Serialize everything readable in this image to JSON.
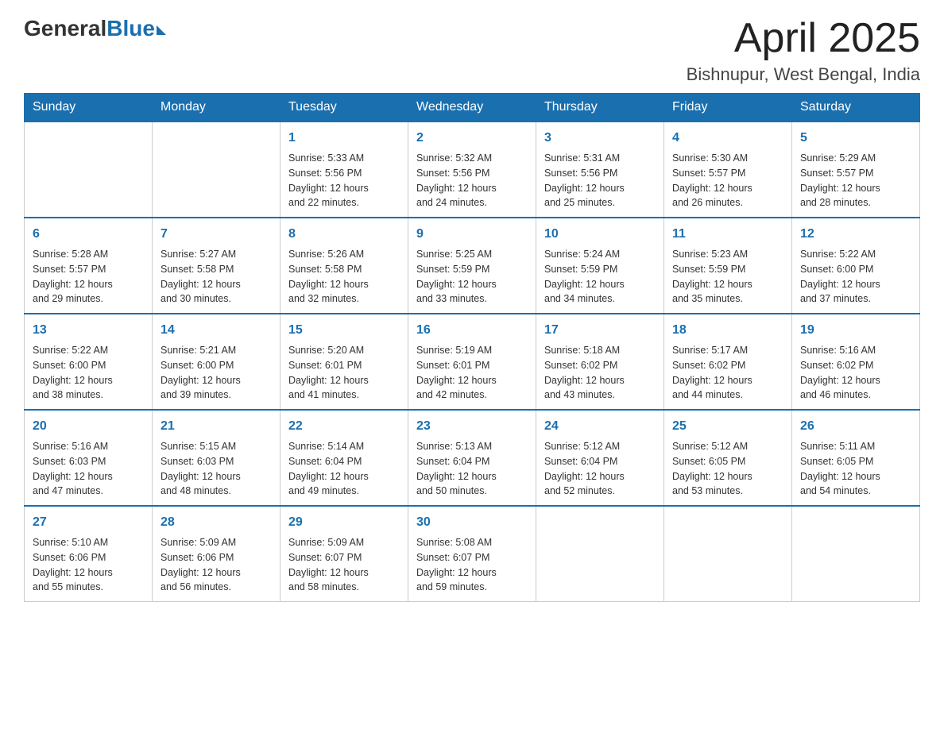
{
  "header": {
    "logo": {
      "general": "General",
      "blue": "Blue"
    },
    "title": "April 2025",
    "location": "Bishnupur, West Bengal, India"
  },
  "weekdays": [
    "Sunday",
    "Monday",
    "Tuesday",
    "Wednesday",
    "Thursday",
    "Friday",
    "Saturday"
  ],
  "weeks": [
    [
      {
        "day": "",
        "info": ""
      },
      {
        "day": "",
        "info": ""
      },
      {
        "day": "1",
        "info": "Sunrise: 5:33 AM\nSunset: 5:56 PM\nDaylight: 12 hours\nand 22 minutes."
      },
      {
        "day": "2",
        "info": "Sunrise: 5:32 AM\nSunset: 5:56 PM\nDaylight: 12 hours\nand 24 minutes."
      },
      {
        "day": "3",
        "info": "Sunrise: 5:31 AM\nSunset: 5:56 PM\nDaylight: 12 hours\nand 25 minutes."
      },
      {
        "day": "4",
        "info": "Sunrise: 5:30 AM\nSunset: 5:57 PM\nDaylight: 12 hours\nand 26 minutes."
      },
      {
        "day": "5",
        "info": "Sunrise: 5:29 AM\nSunset: 5:57 PM\nDaylight: 12 hours\nand 28 minutes."
      }
    ],
    [
      {
        "day": "6",
        "info": "Sunrise: 5:28 AM\nSunset: 5:57 PM\nDaylight: 12 hours\nand 29 minutes."
      },
      {
        "day": "7",
        "info": "Sunrise: 5:27 AM\nSunset: 5:58 PM\nDaylight: 12 hours\nand 30 minutes."
      },
      {
        "day": "8",
        "info": "Sunrise: 5:26 AM\nSunset: 5:58 PM\nDaylight: 12 hours\nand 32 minutes."
      },
      {
        "day": "9",
        "info": "Sunrise: 5:25 AM\nSunset: 5:59 PM\nDaylight: 12 hours\nand 33 minutes."
      },
      {
        "day": "10",
        "info": "Sunrise: 5:24 AM\nSunset: 5:59 PM\nDaylight: 12 hours\nand 34 minutes."
      },
      {
        "day": "11",
        "info": "Sunrise: 5:23 AM\nSunset: 5:59 PM\nDaylight: 12 hours\nand 35 minutes."
      },
      {
        "day": "12",
        "info": "Sunrise: 5:22 AM\nSunset: 6:00 PM\nDaylight: 12 hours\nand 37 minutes."
      }
    ],
    [
      {
        "day": "13",
        "info": "Sunrise: 5:22 AM\nSunset: 6:00 PM\nDaylight: 12 hours\nand 38 minutes."
      },
      {
        "day": "14",
        "info": "Sunrise: 5:21 AM\nSunset: 6:00 PM\nDaylight: 12 hours\nand 39 minutes."
      },
      {
        "day": "15",
        "info": "Sunrise: 5:20 AM\nSunset: 6:01 PM\nDaylight: 12 hours\nand 41 minutes."
      },
      {
        "day": "16",
        "info": "Sunrise: 5:19 AM\nSunset: 6:01 PM\nDaylight: 12 hours\nand 42 minutes."
      },
      {
        "day": "17",
        "info": "Sunrise: 5:18 AM\nSunset: 6:02 PM\nDaylight: 12 hours\nand 43 minutes."
      },
      {
        "day": "18",
        "info": "Sunrise: 5:17 AM\nSunset: 6:02 PM\nDaylight: 12 hours\nand 44 minutes."
      },
      {
        "day": "19",
        "info": "Sunrise: 5:16 AM\nSunset: 6:02 PM\nDaylight: 12 hours\nand 46 minutes."
      }
    ],
    [
      {
        "day": "20",
        "info": "Sunrise: 5:16 AM\nSunset: 6:03 PM\nDaylight: 12 hours\nand 47 minutes."
      },
      {
        "day": "21",
        "info": "Sunrise: 5:15 AM\nSunset: 6:03 PM\nDaylight: 12 hours\nand 48 minutes."
      },
      {
        "day": "22",
        "info": "Sunrise: 5:14 AM\nSunset: 6:04 PM\nDaylight: 12 hours\nand 49 minutes."
      },
      {
        "day": "23",
        "info": "Sunrise: 5:13 AM\nSunset: 6:04 PM\nDaylight: 12 hours\nand 50 minutes."
      },
      {
        "day": "24",
        "info": "Sunrise: 5:12 AM\nSunset: 6:04 PM\nDaylight: 12 hours\nand 52 minutes."
      },
      {
        "day": "25",
        "info": "Sunrise: 5:12 AM\nSunset: 6:05 PM\nDaylight: 12 hours\nand 53 minutes."
      },
      {
        "day": "26",
        "info": "Sunrise: 5:11 AM\nSunset: 6:05 PM\nDaylight: 12 hours\nand 54 minutes."
      }
    ],
    [
      {
        "day": "27",
        "info": "Sunrise: 5:10 AM\nSunset: 6:06 PM\nDaylight: 12 hours\nand 55 minutes."
      },
      {
        "day": "28",
        "info": "Sunrise: 5:09 AM\nSunset: 6:06 PM\nDaylight: 12 hours\nand 56 minutes."
      },
      {
        "day": "29",
        "info": "Sunrise: 5:09 AM\nSunset: 6:07 PM\nDaylight: 12 hours\nand 58 minutes."
      },
      {
        "day": "30",
        "info": "Sunrise: 5:08 AM\nSunset: 6:07 PM\nDaylight: 12 hours\nand 59 minutes."
      },
      {
        "day": "",
        "info": ""
      },
      {
        "day": "",
        "info": ""
      },
      {
        "day": "",
        "info": ""
      }
    ]
  ]
}
